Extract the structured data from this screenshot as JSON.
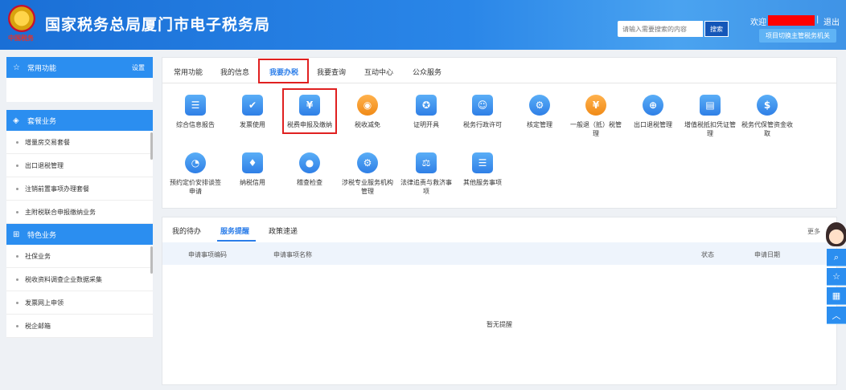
{
  "header": {
    "emblem_text": "中国税务",
    "title": "国家税务总局厦门市电子税务局",
    "search_placeholder": "请输入需要搜索的内容",
    "search_button": "搜索",
    "welcome": "欢迎",
    "separator": "|",
    "logout": "退出",
    "switch_button": "项目切换主管税务机关"
  },
  "sidebar": {
    "common": {
      "label": "常用功能",
      "setting": "设置"
    },
    "package": {
      "label": "套餐业务",
      "items": [
        "增量房交易套餐",
        "出口退税管理",
        "注销前置事项办理套餐",
        "主附税联合申报缴纳业务"
      ]
    },
    "special": {
      "label": "特色业务",
      "items": [
        "社保业务",
        "税收资料调查企业数据采集",
        "发票网上申领",
        "税企邮箱"
      ]
    }
  },
  "main_tabs": [
    "常用功能",
    "我的信息",
    "我要办税",
    "我要查询",
    "互动中心",
    "公众服务"
  ],
  "service_items": [
    "综合信息报告",
    "发票使用",
    "税费申报及缴纳",
    "税收减免",
    "证明开具",
    "税务行政许可",
    "核定管理",
    "一般退（抵）税管理",
    "出口退税管理",
    "增值税抵扣凭证管理",
    "税务代保管资金收取",
    "预约定价安排谈签申请",
    "纳税信用",
    "稽查检查",
    "涉税专业服务机构管理",
    "法律追责与救济事项",
    "其他服务事项"
  ],
  "bottom_panel": {
    "tabs": [
      "我的待办",
      "服务提醒",
      "政策速递"
    ],
    "more": "更多",
    "columns": [
      "申请事项编码",
      "申请事项名称",
      "状态",
      "申请日期"
    ],
    "empty_text": "暂无提醒"
  },
  "icons": {
    "common": "star-icon",
    "package": "layers-icon",
    "special": "grid-icon"
  },
  "colors": {
    "primary": "#2b8ef0",
    "active_tab": "#2b7de9",
    "highlight": "#e02020"
  }
}
